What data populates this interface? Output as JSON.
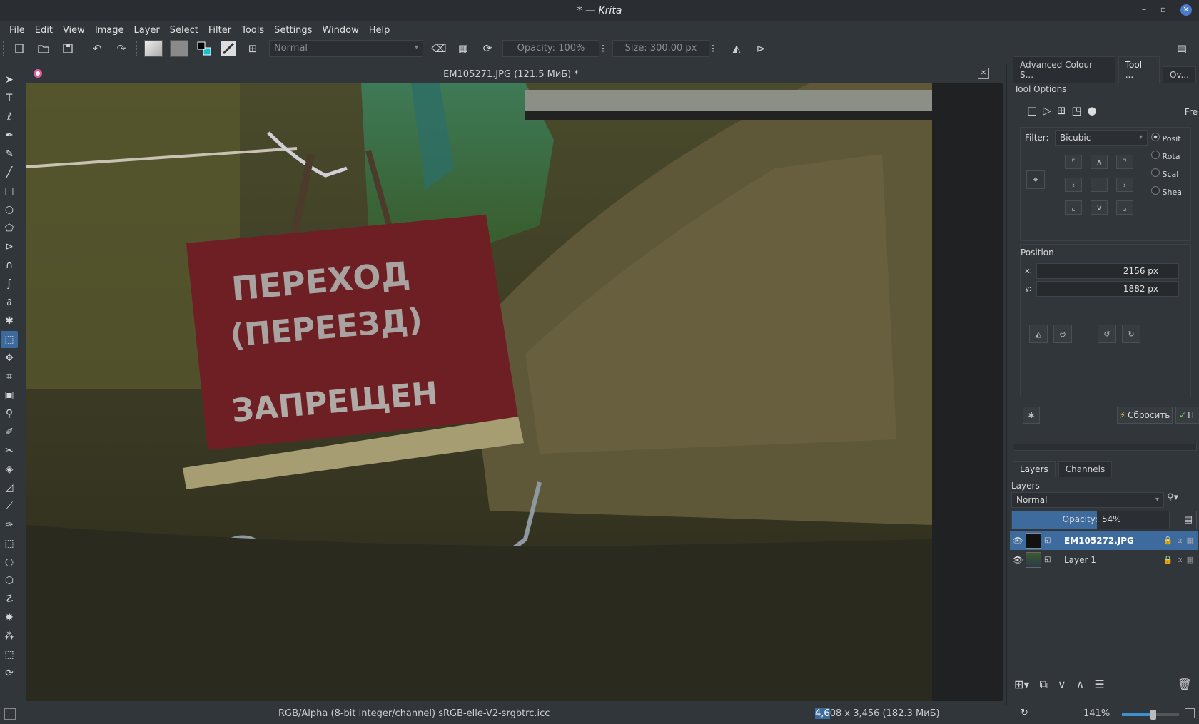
{
  "window": {
    "title_prefix": "* — ",
    "title_app": "Krita",
    "min": "–",
    "restore": "▫",
    "close": "✕"
  },
  "menu": [
    {
      "label": "File"
    },
    {
      "label": "Edit"
    },
    {
      "label": "View"
    },
    {
      "label": "Image"
    },
    {
      "label": "Layer"
    },
    {
      "label": "Select"
    },
    {
      "label": "Filter"
    },
    {
      "label": "Tools"
    },
    {
      "label": "Settings"
    },
    {
      "label": "Window"
    },
    {
      "label": "Help"
    }
  ],
  "toolbar": {
    "blend_mode": "Normal",
    "opacity": "Opacity: 100%",
    "size": "Size: 300.00 px"
  },
  "canvas": {
    "tab_title": "EM105271.JPG (121.5 МиБ) *",
    "sign_line1": "ПЕРЕХОД",
    "sign_line2": "(ПЕРЕЕЗД)",
    "sign_line3": "ЗАПРЕЩЕН"
  },
  "right_panel": {
    "tabs": [
      {
        "label": "Advanced Colour S..."
      },
      {
        "label": "Tool ..."
      },
      {
        "label": "Ov..."
      }
    ],
    "tool_options_title": "Tool Options",
    "free_label": "Fre",
    "filter_label": "Filter:",
    "filter_value": "Bicubic",
    "radios": [
      {
        "label": "Posit"
      },
      {
        "label": "Rota"
      },
      {
        "label": "Scal"
      },
      {
        "label": "Shea"
      }
    ],
    "position_label": "Position",
    "x_label": "x:",
    "x_value": "2156 px",
    "y_label": "y:",
    "y_value": "1882 px",
    "reset_label": "Сбросить",
    "apply_label": "П"
  },
  "layers_panel": {
    "tabs": [
      {
        "label": "Layers"
      },
      {
        "label": "Channels"
      }
    ],
    "title": "Layers",
    "blend_mode": "Normal",
    "opacity_label": "Opacity:",
    "opacity_value": "54%",
    "opacity_fraction": 0.54,
    "layers": [
      {
        "name": "EM105272.JPG",
        "selected": true
      },
      {
        "name": "Layer 1",
        "selected": false
      }
    ]
  },
  "status": {
    "color_space": "RGB/Alpha (8-bit integer/channel)  sRGB-elle-V2-srgbtrc.icc",
    "dimensions_prefix": "4,6",
    "dimensions_rest": "08 x 3,456 (182.3 МиБ)",
    "zoom": "141%",
    "zoom_fraction": 0.55
  }
}
